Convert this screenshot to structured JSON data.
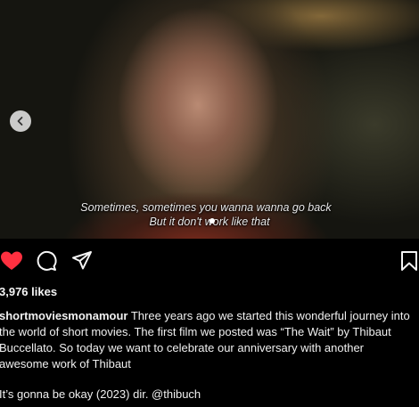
{
  "media": {
    "subtitle_line1": "Sometimes, sometimes you wanna wanna go back",
    "subtitle_line2": "But it don't work like that",
    "prev_icon": "chevron-left-icon",
    "carousel_dots": 1
  },
  "actions": {
    "like_icon": "heart-filled-icon",
    "like_color": "#ff3040",
    "comment_icon": "comment-bubble-icon",
    "share_icon": "paper-plane-icon",
    "save_icon": "bookmark-icon"
  },
  "likes": "3,976 likes",
  "caption": {
    "username": "shortmoviesmonamour",
    "text": " Three years ago we started this wonderful journey into the world of short movies. The first film we posted was “The Wait” by Thibaut Buccellato. So today we want to celebrate our anniversary with another awesome work of Thibaut"
  },
  "credit": "It’s gonna be okay (2023) dir. @thibuch"
}
